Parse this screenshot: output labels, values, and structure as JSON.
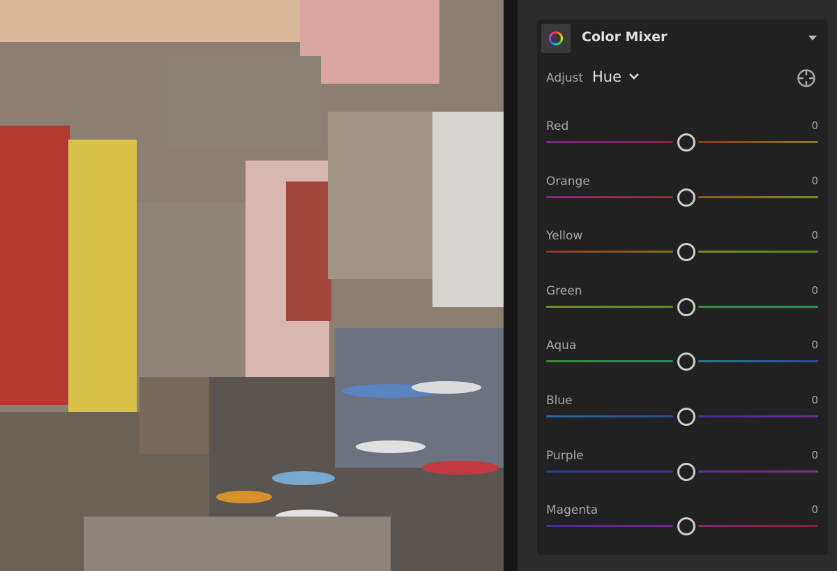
{
  "panel": {
    "title": "Color Mixer",
    "icon": "color-wheel-icon",
    "adjust_label": "Adjust",
    "adjust_value": "Hue",
    "targeted_adjustment_icon": "crosshair-target-icon"
  },
  "sliders": [
    {
      "label": "Red",
      "value": "0",
      "colors": [
        "#7a2a8c",
        "#8c2350",
        "#8c3a1e",
        "#8c7d22"
      ]
    },
    {
      "label": "Orange",
      "value": "0",
      "colors": [
        "#8a2a78",
        "#8c3030",
        "#8c5a1e",
        "#7a8c22"
      ]
    },
    {
      "label": "Yellow",
      "value": "0",
      "colors": [
        "#8c3a1e",
        "#8c6a1e",
        "#7c8c22",
        "#4a8c22"
      ]
    },
    {
      "label": "Green",
      "value": "0",
      "colors": [
        "#6e8c22",
        "#5a8c22",
        "#3a8c30",
        "#2a8c66"
      ]
    },
    {
      "label": "Aqua",
      "value": "0",
      "colors": [
        "#3a8c30",
        "#2a8c66",
        "#2a7a8c",
        "#2a4a9c"
      ]
    },
    {
      "label": "Blue",
      "value": "0",
      "colors": [
        "#2a6a9c",
        "#2a4a9c",
        "#4a2a9c",
        "#6a2a9c"
      ]
    },
    {
      "label": "Purple",
      "value": "0",
      "colors": [
        "#2a3a9c",
        "#4a2a9c",
        "#6a2a9c",
        "#8a2a8c"
      ]
    },
    {
      "label": "Magenta",
      "value": "0",
      "colors": [
        "#4a2a9c",
        "#7a2a8c",
        "#8a2a78",
        "#8c2030"
      ]
    }
  ]
}
